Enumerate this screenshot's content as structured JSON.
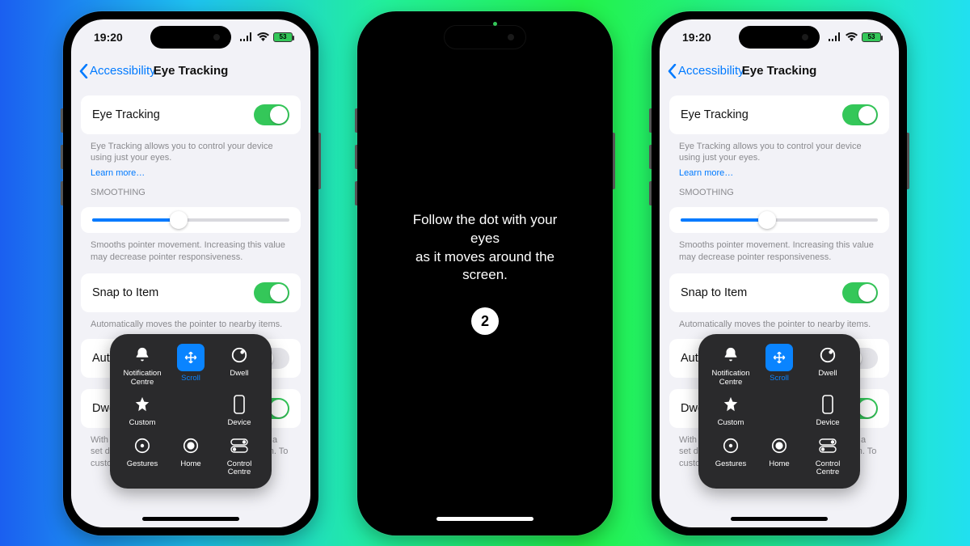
{
  "status": {
    "time": "19:20",
    "battery": "53"
  },
  "nav": {
    "back": "Accessibility",
    "title": "Eye Tracking"
  },
  "rows": {
    "eyeTracking": "Eye Tracking",
    "eyeTrackingDesc": "Eye Tracking allows you to control your device using just your eyes.",
    "learnMore": "Learn more…",
    "smoothingHeader": "Smoothing",
    "smoothingDesc": "Smooths pointer movement. Increasing this value may decrease pointer responsiveness.",
    "snap": "Snap to Item",
    "snapDesc": "Automatically moves the pointer to nearby items.",
    "autoHide": "Auto-Hide",
    "dwell": "Dwell Control",
    "dwellDesc": "With Dwell Control, holding the pointer still for a set duration performs the selected dwell action. To customise, go to…"
  },
  "toggles": {
    "eyeTracking": true,
    "snap": true,
    "autoHide": false,
    "dwell": true
  },
  "slider": {
    "value": 44
  },
  "atMenu": {
    "notif": "Notification Centre",
    "scroll": "Scroll",
    "dwell": "Dwell",
    "custom": "Custom",
    "device": "Device",
    "gestures": "Gestures",
    "home": "Home",
    "control": "Control Centre"
  },
  "calibration": {
    "line1": "Follow the dot with your eyes",
    "line2": "as it moves around the screen.",
    "count": "2"
  }
}
